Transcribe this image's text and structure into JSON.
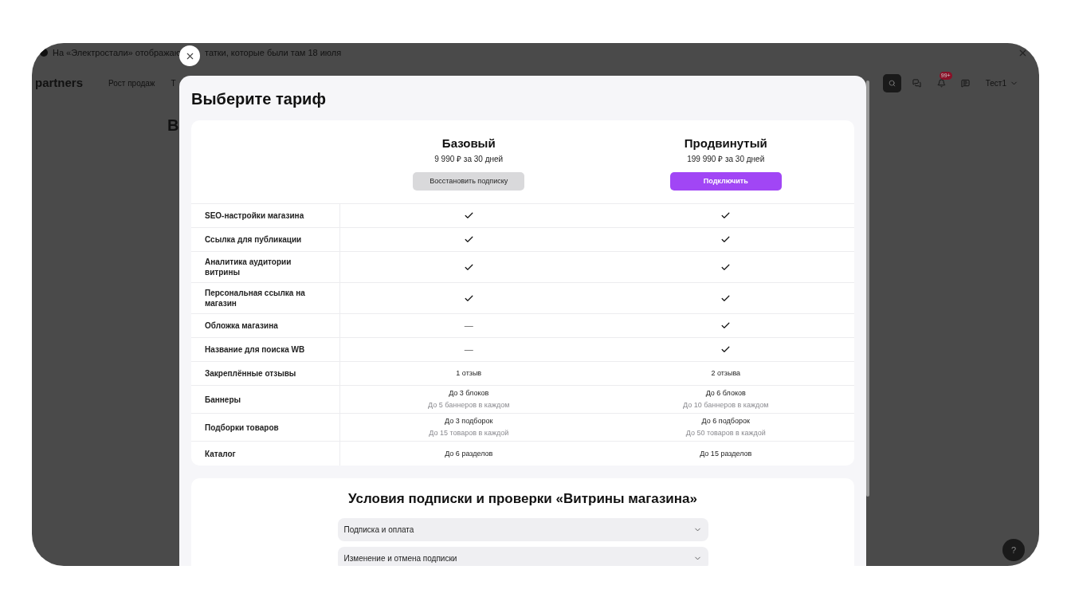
{
  "banner": {
    "text_before": "На «Электростали» отображаю",
    "text_after": "татки, которые были там 18 июля"
  },
  "nav": {
    "logo": "partners",
    "items": [
      "Рост продаж",
      "Т"
    ],
    "notifications": "99+",
    "user": "Тест1"
  },
  "page": {
    "heading": "В"
  },
  "help": "?",
  "modal": {
    "title": "Выберите тариф",
    "plans": [
      {
        "name": "Базовый",
        "price": "9 990 ₽ за 30 дней",
        "button": "Восстановить подписку",
        "primary": false
      },
      {
        "name": "Продвинутый",
        "price": "199 990 ₽ за 30 дней",
        "button": "Подключить",
        "primary": true
      }
    ],
    "features": [
      {
        "name": "SEO-настройки магазина",
        "values": [
          {
            "kind": "check"
          },
          {
            "kind": "check"
          }
        ]
      },
      {
        "name": "Ссылка для публикации",
        "values": [
          {
            "kind": "check"
          },
          {
            "kind": "check"
          }
        ]
      },
      {
        "name": "Аналитика аудитории витрины",
        "values": [
          {
            "kind": "check"
          },
          {
            "kind": "check"
          }
        ]
      },
      {
        "name": "Персональная ссылка на магазин",
        "values": [
          {
            "kind": "check"
          },
          {
            "kind": "check"
          }
        ]
      },
      {
        "name": "Обложка магазина",
        "values": [
          {
            "kind": "dash",
            "text": "—"
          },
          {
            "kind": "check"
          }
        ]
      },
      {
        "name": "Название для поиска WB",
        "values": [
          {
            "kind": "dash",
            "text": "—"
          },
          {
            "kind": "check"
          }
        ]
      },
      {
        "name": "Закреплённые отзывы",
        "values": [
          {
            "kind": "text",
            "text": "1 отзыв"
          },
          {
            "kind": "text",
            "text": "2 отзыва"
          }
        ]
      },
      {
        "name": "Баннеры",
        "values": [
          {
            "kind": "text",
            "text": "До 3 блоков",
            "note": "До 5 баннеров в каждом"
          },
          {
            "kind": "text",
            "text": "До 6 блоков",
            "note": "До 10 баннеров в каждом"
          }
        ]
      },
      {
        "name": "Подборки товаров",
        "values": [
          {
            "kind": "text",
            "text": "До 3 подборок",
            "note": "До 15 товаров в каждой"
          },
          {
            "kind": "text",
            "text": "До 6 подборок",
            "note": "До 50 товаров в каждой"
          }
        ]
      },
      {
        "name": "Каталог",
        "values": [
          {
            "kind": "text",
            "text": "До 6 разделов"
          },
          {
            "kind": "text",
            "text": "До 15 разделов"
          }
        ]
      }
    ],
    "terms": {
      "title": "Условия подписки и проверки «Витрины магазина»",
      "items": [
        {
          "title": "Подписка и оплата",
          "expanded": false
        },
        {
          "title": "Изменение и отмена подписки",
          "expanded": false
        }
      ]
    }
  }
}
